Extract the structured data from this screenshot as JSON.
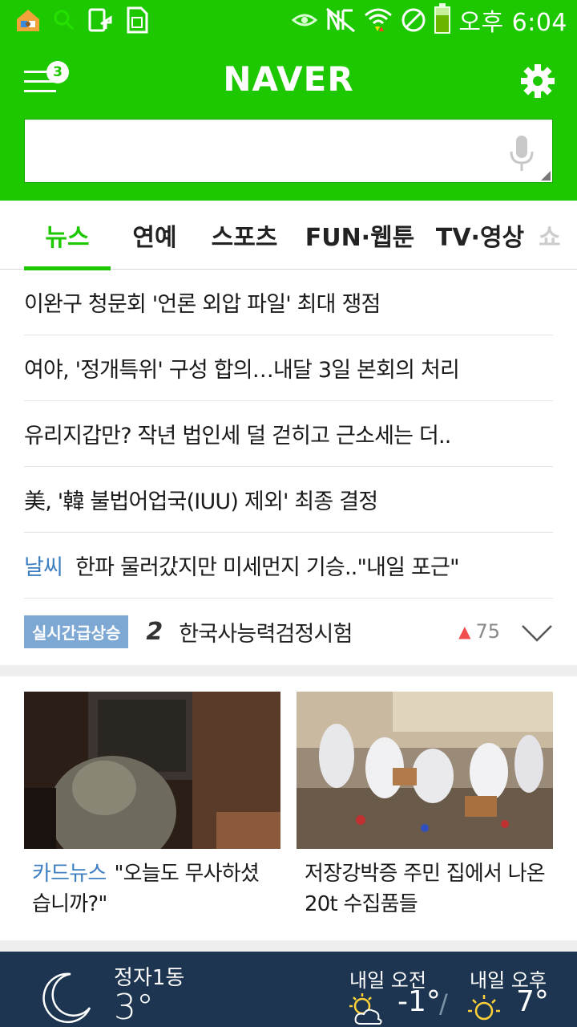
{
  "status_bar": {
    "time": "오후 6:04",
    "icons": [
      "home-icon",
      "search-icon",
      "phone-transfer-icon",
      "sim-icon",
      "eye-icon",
      "no-nfc-icon",
      "wifi-icon",
      "do-not-disturb-icon",
      "battery-icon"
    ]
  },
  "header": {
    "logo": "NAVER",
    "menu_badge": "3",
    "search_placeholder": "",
    "search_value": ""
  },
  "tabs": [
    {
      "label": "뉴스",
      "active": true
    },
    {
      "label": "연예",
      "active": false
    },
    {
      "label": "스포츠",
      "active": false
    },
    {
      "label": "FUN·웹툰",
      "active": false
    },
    {
      "label": "TV·영상",
      "active": false
    },
    {
      "label": "쇼",
      "active": false
    }
  ],
  "headlines": [
    {
      "text": "이완구 청문회 '언론 외압 파일' 최대 쟁점"
    },
    {
      "text": "여야, '정개특위' 구성 합의…내달 3일 본회의 처리"
    },
    {
      "text": "유리지갑만? 작년 법인세 덜 걷히고 근소세는 더.."
    },
    {
      "text": "美, '韓 불법어업국(IUU) 제외' 최종 결정"
    },
    {
      "tag": "날씨",
      "text": "한파 물러갔지만 미세먼지 기승..\"내일 포근\""
    }
  ],
  "realtime": {
    "label": "실시간급상승",
    "rank": "2",
    "keyword": "한국사능력검정시험",
    "up_icon": "▲",
    "count": "75"
  },
  "cards": [
    {
      "tag": "카드뉴스",
      "line1": "\"오늘도 무사하셨",
      "line2": "습니까?\""
    },
    {
      "tag": "",
      "line1": "저장강박증 주민 집에서 나온",
      "line2": "20t 수집품들"
    }
  ],
  "weather": {
    "location": "정자1동",
    "current_temp": "3°",
    "tomorrow_am_label": "내일 오전",
    "tomorrow_am_temp": "-1°",
    "tomorrow_pm_label": "내일 오후",
    "tomorrow_pm_temp": "7°",
    "separator": "/"
  },
  "colors": {
    "naver_green": "#1ec800",
    "link_blue": "#3d7fc1",
    "weather_bg": "#1d3550",
    "up_red": "#f04e4e"
  }
}
